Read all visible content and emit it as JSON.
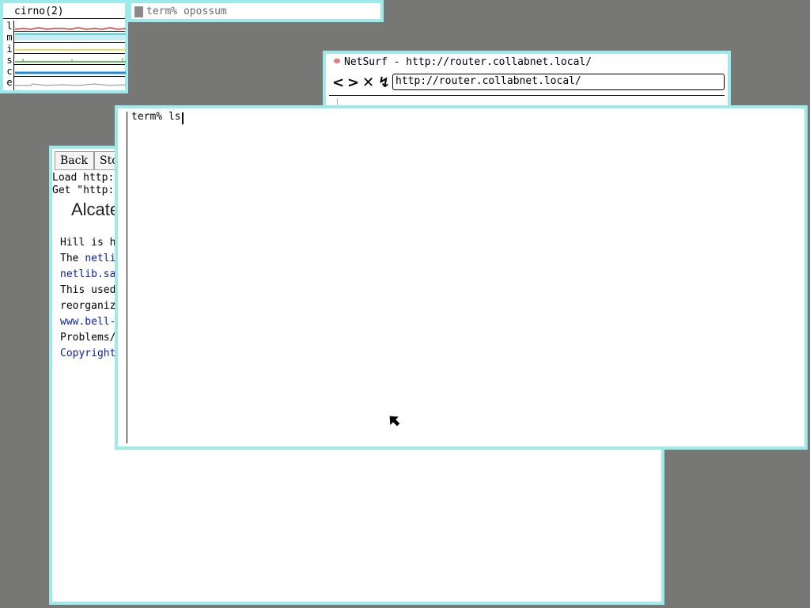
{
  "stats": {
    "title": "cirno(2)",
    "letters": [
      "l",
      "m",
      "i",
      "s",
      "c",
      "e"
    ],
    "graph_colors": [
      "#d83a3a",
      "#37c9d8",
      "#e4d23a",
      "#36a62f",
      "#1d8ce0",
      "#8a8a8a"
    ],
    "graph_icons": [
      "load-graph-icon",
      "memory-graph-icon",
      "interrupts-graph-icon",
      "syscalls-graph-icon",
      "context-graph-icon",
      "ethernet-graph-icon"
    ]
  },
  "term_label": {
    "text": "term% opossum"
  },
  "netsurf": {
    "title": "NetSurf - http://router.collabnet.local/",
    "back": "<",
    "forward": ">",
    "stop": "✕",
    "reload": "↯",
    "url": "http://router.collabnet.local/"
  },
  "abaco": {
    "back_label": "Back",
    "stop_label": "Sto",
    "status_lines": [
      "Load http:",
      "Get \"http:"
    ],
    "brand": "Alcate",
    "content": [
      {
        "text": "Hill is h",
        "link": false
      },
      {
        "text": "The ",
        "link": false,
        "link_text": "netli"
      },
      {
        "text": "netlib.sa",
        "link": true
      },
      {
        "text": "This used",
        "link": false
      },
      {
        "text": "reorganiz",
        "link": false
      },
      {
        "text": "www.bell-",
        "link": true
      },
      {
        "text": "Problems/",
        "link": false
      },
      {
        "text": "Copyright",
        "link": true
      }
    ]
  },
  "terminal": {
    "prompt_line": "term% ls"
  },
  "colors": {
    "desktop": "#777776",
    "window_border": "#9ee9e9",
    "link": "#0a1d9c"
  }
}
